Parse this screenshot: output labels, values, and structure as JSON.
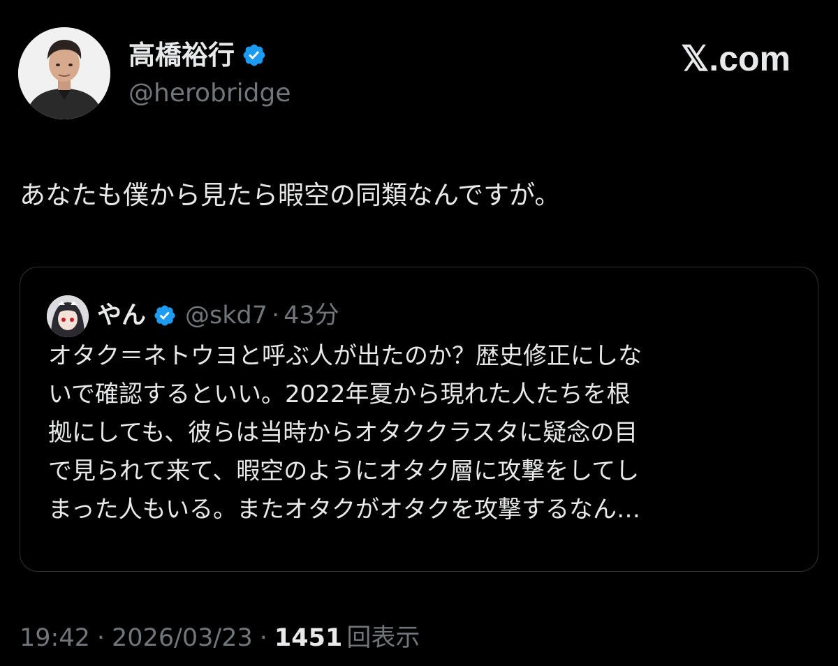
{
  "brand": "𝕏.com",
  "author": {
    "name": "高橋裕行",
    "handle": "@herobridge",
    "verified": true,
    "avatar_icon": "person-avatar-icon"
  },
  "tweet": {
    "text": "あなたも僕から見たら暇空の同類なんですが。"
  },
  "quote": {
    "name": "やん",
    "handle": "@skd7",
    "dot": "·",
    "time": "43分",
    "verified": true,
    "avatar_icon": "anime-avatar-icon",
    "text": "オタク＝ネトウヨと呼ぶ人が出たのか？歴史修正にしな\nいで確認するといい。2022年夏から現れた人たちを根\n拠にしても、彼らは当時からオタククラスタに疑念の目\nで見られて来て、暇空のようにオタク層に攻撃をしてし\nまった人もいる。またオタクがオタクを攻撃するなん…"
  },
  "meta": {
    "time": "19:42",
    "sep1": "·",
    "date": "2026/03/23",
    "sep2": "·",
    "views": "1451",
    "views_label": "回表示"
  },
  "colors": {
    "background": "#000000",
    "text": "#e7e9ea",
    "muted": "#71767b",
    "verified_blue": "#1d9bf0",
    "border": "#2f3336"
  }
}
